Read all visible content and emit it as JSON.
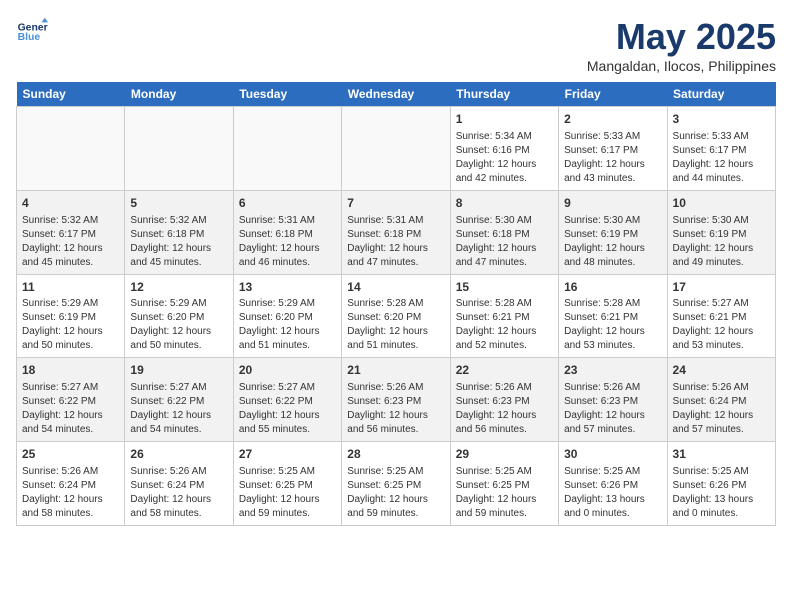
{
  "header": {
    "logo_line1": "General",
    "logo_line2": "Blue",
    "month": "May 2025",
    "location": "Mangaldan, Ilocos, Philippines"
  },
  "weekdays": [
    "Sunday",
    "Monday",
    "Tuesday",
    "Wednesday",
    "Thursday",
    "Friday",
    "Saturday"
  ],
  "weeks": [
    [
      {
        "day": "",
        "info": ""
      },
      {
        "day": "",
        "info": ""
      },
      {
        "day": "",
        "info": ""
      },
      {
        "day": "",
        "info": ""
      },
      {
        "day": "1",
        "info": "Sunrise: 5:34 AM\nSunset: 6:16 PM\nDaylight: 12 hours and 42 minutes."
      },
      {
        "day": "2",
        "info": "Sunrise: 5:33 AM\nSunset: 6:17 PM\nDaylight: 12 hours and 43 minutes."
      },
      {
        "day": "3",
        "info": "Sunrise: 5:33 AM\nSunset: 6:17 PM\nDaylight: 12 hours and 44 minutes."
      }
    ],
    [
      {
        "day": "4",
        "info": "Sunrise: 5:32 AM\nSunset: 6:17 PM\nDaylight: 12 hours and 45 minutes."
      },
      {
        "day": "5",
        "info": "Sunrise: 5:32 AM\nSunset: 6:18 PM\nDaylight: 12 hours and 45 minutes."
      },
      {
        "day": "6",
        "info": "Sunrise: 5:31 AM\nSunset: 6:18 PM\nDaylight: 12 hours and 46 minutes."
      },
      {
        "day": "7",
        "info": "Sunrise: 5:31 AM\nSunset: 6:18 PM\nDaylight: 12 hours and 47 minutes."
      },
      {
        "day": "8",
        "info": "Sunrise: 5:30 AM\nSunset: 6:18 PM\nDaylight: 12 hours and 47 minutes."
      },
      {
        "day": "9",
        "info": "Sunrise: 5:30 AM\nSunset: 6:19 PM\nDaylight: 12 hours and 48 minutes."
      },
      {
        "day": "10",
        "info": "Sunrise: 5:30 AM\nSunset: 6:19 PM\nDaylight: 12 hours and 49 minutes."
      }
    ],
    [
      {
        "day": "11",
        "info": "Sunrise: 5:29 AM\nSunset: 6:19 PM\nDaylight: 12 hours and 50 minutes."
      },
      {
        "day": "12",
        "info": "Sunrise: 5:29 AM\nSunset: 6:20 PM\nDaylight: 12 hours and 50 minutes."
      },
      {
        "day": "13",
        "info": "Sunrise: 5:29 AM\nSunset: 6:20 PM\nDaylight: 12 hours and 51 minutes."
      },
      {
        "day": "14",
        "info": "Sunrise: 5:28 AM\nSunset: 6:20 PM\nDaylight: 12 hours and 51 minutes."
      },
      {
        "day": "15",
        "info": "Sunrise: 5:28 AM\nSunset: 6:21 PM\nDaylight: 12 hours and 52 minutes."
      },
      {
        "day": "16",
        "info": "Sunrise: 5:28 AM\nSunset: 6:21 PM\nDaylight: 12 hours and 53 minutes."
      },
      {
        "day": "17",
        "info": "Sunrise: 5:27 AM\nSunset: 6:21 PM\nDaylight: 12 hours and 53 minutes."
      }
    ],
    [
      {
        "day": "18",
        "info": "Sunrise: 5:27 AM\nSunset: 6:22 PM\nDaylight: 12 hours and 54 minutes."
      },
      {
        "day": "19",
        "info": "Sunrise: 5:27 AM\nSunset: 6:22 PM\nDaylight: 12 hours and 54 minutes."
      },
      {
        "day": "20",
        "info": "Sunrise: 5:27 AM\nSunset: 6:22 PM\nDaylight: 12 hours and 55 minutes."
      },
      {
        "day": "21",
        "info": "Sunrise: 5:26 AM\nSunset: 6:23 PM\nDaylight: 12 hours and 56 minutes."
      },
      {
        "day": "22",
        "info": "Sunrise: 5:26 AM\nSunset: 6:23 PM\nDaylight: 12 hours and 56 minutes."
      },
      {
        "day": "23",
        "info": "Sunrise: 5:26 AM\nSunset: 6:23 PM\nDaylight: 12 hours and 57 minutes."
      },
      {
        "day": "24",
        "info": "Sunrise: 5:26 AM\nSunset: 6:24 PM\nDaylight: 12 hours and 57 minutes."
      }
    ],
    [
      {
        "day": "25",
        "info": "Sunrise: 5:26 AM\nSunset: 6:24 PM\nDaylight: 12 hours and 58 minutes."
      },
      {
        "day": "26",
        "info": "Sunrise: 5:26 AM\nSunset: 6:24 PM\nDaylight: 12 hours and 58 minutes."
      },
      {
        "day": "27",
        "info": "Sunrise: 5:25 AM\nSunset: 6:25 PM\nDaylight: 12 hours and 59 minutes."
      },
      {
        "day": "28",
        "info": "Sunrise: 5:25 AM\nSunset: 6:25 PM\nDaylight: 12 hours and 59 minutes."
      },
      {
        "day": "29",
        "info": "Sunrise: 5:25 AM\nSunset: 6:25 PM\nDaylight: 12 hours and 59 minutes."
      },
      {
        "day": "30",
        "info": "Sunrise: 5:25 AM\nSunset: 6:26 PM\nDaylight: 13 hours and 0 minutes."
      },
      {
        "day": "31",
        "info": "Sunrise: 5:25 AM\nSunset: 6:26 PM\nDaylight: 13 hours and 0 minutes."
      }
    ]
  ]
}
